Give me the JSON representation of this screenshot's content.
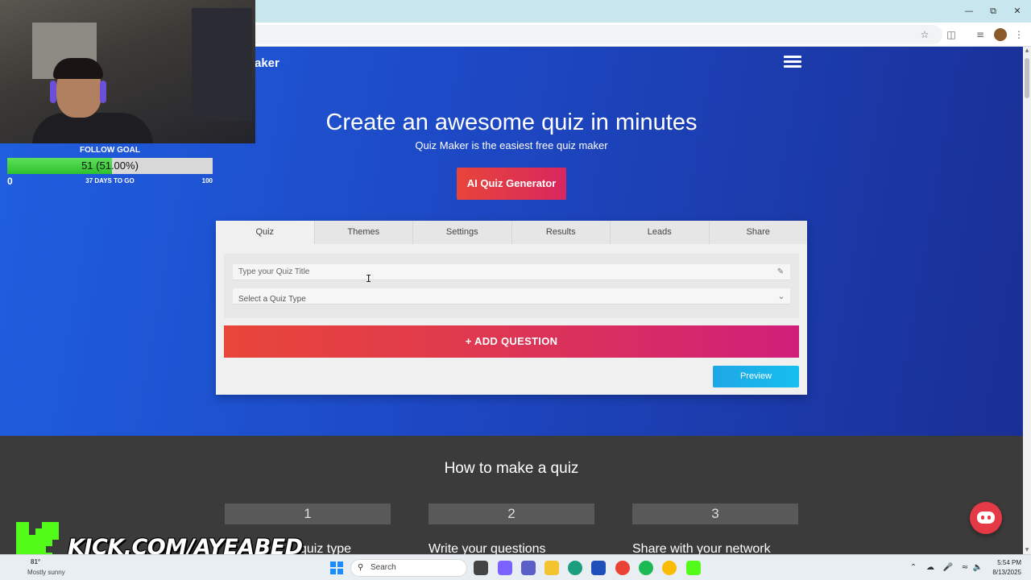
{
  "browser": {
    "icons": [
      "bookmark-star-icon",
      "cast-icon",
      "tab-search-icon",
      "profile-avatar",
      "more-icon"
    ],
    "window_controls": [
      "minimize-icon",
      "restore-icon",
      "close-icon"
    ]
  },
  "site": {
    "brand_partial": "aker",
    "hero_title": "Create an awesome quiz in minutes",
    "hero_subtitle": "Quiz Maker is the easiest free quiz maker",
    "ai_button": "AI Quiz Generator"
  },
  "editor": {
    "tabs": [
      "Quiz",
      "Themes",
      "Settings",
      "Results",
      "Leads",
      "Share"
    ],
    "active_tab": "Quiz",
    "title_placeholder": "Type your Quiz Title",
    "type_select": "Select a Quiz Type",
    "add_question": "+   ADD QUESTION",
    "preview": "Preview"
  },
  "howto": {
    "title": "How to make a quiz",
    "steps": [
      {
        "number": "1",
        "text": "quiz type"
      },
      {
        "number": "2",
        "text": "Write your questions"
      },
      {
        "number": "3",
        "text": "Share with your network"
      }
    ]
  },
  "overlay": {
    "follow_goal_label": "FOLLOW GOAL",
    "follow_goal_value": "51 (51.00%)",
    "follow_goal_progress": 0.51,
    "follow_min": "0",
    "follow_days": "37 DAYS TO GO",
    "follow_max": "100",
    "kick_text": "KICK.COM/AYEABED",
    "colors": {
      "progress": "#3fd03c",
      "kick": "#53fc18"
    }
  },
  "taskbar": {
    "weather_temp": "81°",
    "weather_text": "Mostly sunny",
    "search": "Search",
    "time": "5:54 PM",
    "date": "8/13/2025"
  },
  "colors": {
    "hero_start": "#1f5fe0",
    "hero_end": "#1a2f95",
    "add_question_start": "#e8463a",
    "add_question_end": "#cf1f7a",
    "preview": "#1fa6e6",
    "ai_button": "#e8443a"
  }
}
